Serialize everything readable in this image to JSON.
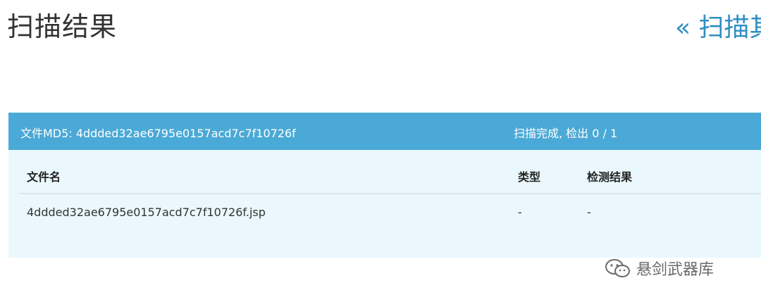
{
  "header": {
    "title": "扫描结果",
    "back_link": "« 扫描其"
  },
  "panel": {
    "md5_label": "文件MD5: 4ddded32ae6795e0157acd7c7f10726f",
    "status": "扫描完成, 检出 0 / 1"
  },
  "table": {
    "columns": [
      "文件名",
      "类型",
      "检测结果"
    ],
    "rows": [
      [
        "4ddded32ae6795e0157acd7c7f10726f.jsp",
        "-",
        "-"
      ]
    ]
  },
  "watermark": {
    "text": "悬剑武器库",
    "icon": "wechat-icon"
  },
  "colors": {
    "header_bg": "#4aa9d6",
    "panel_bg": "#eaf8fe",
    "link": "#2f8ec2"
  }
}
